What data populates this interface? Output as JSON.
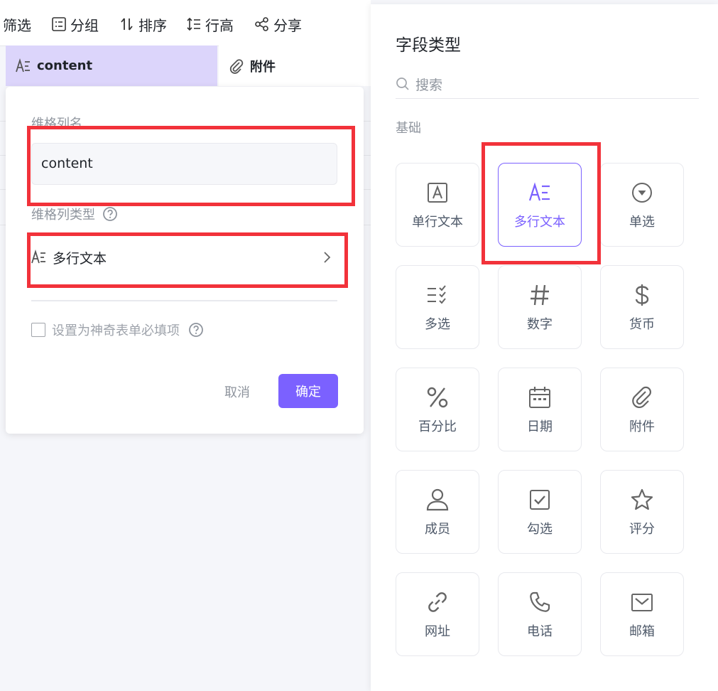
{
  "toolbar": {
    "filter": "筛选",
    "group": "分组",
    "sort": "排序",
    "row_height": "行高",
    "share": "分享"
  },
  "columns": {
    "content": "content",
    "attachment": "附件"
  },
  "popup": {
    "name_label": "维格列名",
    "name_value": "content",
    "type_label": "维格列类型",
    "type_value": "多行文本",
    "required_label": "设置为神奇表单必填项",
    "cancel": "取消",
    "confirm": "确定"
  },
  "panel": {
    "title": "字段类型",
    "search_placeholder": "搜索",
    "section_basic": "基础",
    "types": [
      {
        "label": "单行文本",
        "icon": "single-line-text-icon"
      },
      {
        "label": "多行文本",
        "icon": "multi-line-text-icon",
        "selected": true
      },
      {
        "label": "单选",
        "icon": "single-select-icon"
      },
      {
        "label": "多选",
        "icon": "multi-select-icon"
      },
      {
        "label": "数字",
        "icon": "number-icon"
      },
      {
        "label": "货币",
        "icon": "currency-icon"
      },
      {
        "label": "百分比",
        "icon": "percent-icon"
      },
      {
        "label": "日期",
        "icon": "date-icon"
      },
      {
        "label": "附件",
        "icon": "attachment-icon"
      },
      {
        "label": "成员",
        "icon": "member-icon"
      },
      {
        "label": "勾选",
        "icon": "checkbox-icon"
      },
      {
        "label": "评分",
        "icon": "rating-icon"
      },
      {
        "label": "网址",
        "icon": "url-icon"
      },
      {
        "label": "电话",
        "icon": "phone-icon"
      },
      {
        "label": "邮箱",
        "icon": "email-icon"
      }
    ]
  },
  "colors": {
    "accent": "#7b61ff",
    "highlight": "#f2323a",
    "header_selected": "#dcd5fb"
  }
}
